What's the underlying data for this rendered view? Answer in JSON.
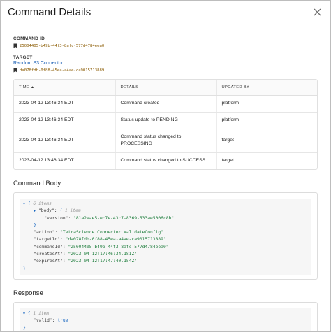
{
  "dialog": {
    "title": "Command Details",
    "close_icon": "close-icon"
  },
  "command_id": {
    "label": "COMMAND ID",
    "icon": "copy-id-icon",
    "value": "25004405-b49b-44f3-8afc-577d4784eea0"
  },
  "target": {
    "label": "TARGET",
    "name": "Random S3 Connector",
    "icon": "copy-id-icon",
    "id": "da078fdb-0f88-45ea-a4ae-ca9015713889"
  },
  "history_table": {
    "columns": [
      "TIME",
      "DETAILS",
      "UPDATED BY"
    ],
    "sort_indicator": "▲",
    "rows": [
      {
        "time": "2023-04-12 13:46:34 EDT",
        "details": "Command created",
        "updated_by": "platform"
      },
      {
        "time": "2023-04-12 13:46:34 EDT",
        "details": "Status update to PENDING",
        "updated_by": "platform"
      },
      {
        "time": "2023-04-12 13:46:34 EDT",
        "details": "Command status changed to PROCESSING",
        "updated_by": "target"
      },
      {
        "time": "2023-04-12 13:46:34 EDT",
        "details": "Command status changed to SUCCESS",
        "updated_by": "target"
      }
    ]
  },
  "command_body": {
    "heading": "Command Body",
    "root_count": "6 items",
    "body_count": "1 item",
    "body_key": "\"body\"",
    "version_key": "\"version\"",
    "version_value": "\"81a2eae5-ec7e-43c7-8369-533ae5006c8b\"",
    "action_key": "\"action\"",
    "action_value": "\"TetraScience.Connector.ValidateConfig\"",
    "targetId_key": "\"targetId\"",
    "targetId_value": "\"da078fdb-0f88-45ea-a4ae-ca9015713889\"",
    "commandId_key": "\"commandId\"",
    "commandId_value": "\"25004405-b49b-44f3-8afc-577d4784eea0\"",
    "createdAt_key": "\"createdAt\"",
    "createdAt_value": "\"2023-04-12T17:46:34.181Z\"",
    "expiresAt_key": "\"expiresAt\"",
    "expiresAt_value": "\"2023-04-12T17:47:40.154Z\""
  },
  "response": {
    "heading": "Response",
    "root_count": "1 item",
    "valid_key": "\"valid\"",
    "valid_value": "true"
  }
}
